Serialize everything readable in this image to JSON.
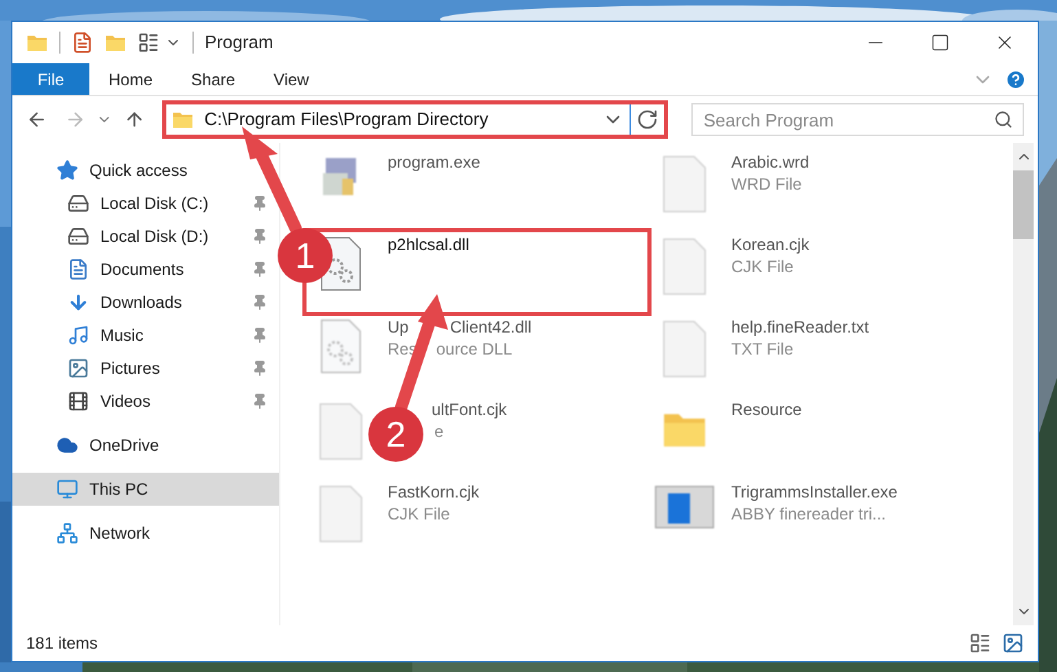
{
  "window": {
    "title": "Program"
  },
  "ribbon_tabs": [
    {
      "label": "File",
      "kind": "file"
    },
    {
      "label": "Home",
      "kind": "tab"
    },
    {
      "label": "Share",
      "kind": "tab"
    },
    {
      "label": "View",
      "kind": "tab"
    }
  ],
  "address": {
    "path": "C:\\Program Files\\Program Directory",
    "highlighted": true
  },
  "search": {
    "placeholder": "Search Program"
  },
  "sidebar": {
    "items": [
      {
        "label": "Quick access",
        "kind": "star",
        "selected": false,
        "children": [
          {
            "label": "Local Disk (C:)",
            "kind": "disk-c",
            "pinned": true,
            "selected": false
          },
          {
            "label": "Local Disk (D:)",
            "kind": "disk",
            "pinned": true,
            "selected": false
          },
          {
            "label": "Documents",
            "kind": "documents",
            "pinned": true,
            "selected": false
          },
          {
            "label": "Downloads",
            "kind": "downloads",
            "pinned": true,
            "selected": false
          },
          {
            "label": "Music",
            "kind": "music",
            "pinned": true,
            "selected": false
          },
          {
            "label": "Pictures",
            "kind": "pictures",
            "pinned": true,
            "selected": false
          },
          {
            "label": "Videos",
            "kind": "videos",
            "pinned": true,
            "selected": false
          }
        ]
      },
      {
        "label": "OneDrive",
        "kind": "cloud",
        "selected": false
      },
      {
        "label": "This PC",
        "kind": "pc",
        "selected": true
      },
      {
        "label": "Network",
        "kind": "network",
        "selected": false
      }
    ]
  },
  "files": [
    {
      "name": "program.exe",
      "kind": "exe",
      "highlighted": false
    },
    {
      "name": "Arabic.wrd",
      "type": "WRD File",
      "kind": "doc",
      "highlighted": false
    },
    {
      "name": "p2hlcsal.dll",
      "kind": "dll",
      "highlighted": true
    },
    {
      "name": "Korean.cjk",
      "type": "CJK File",
      "kind": "doc",
      "highlighted": false
    },
    {
      "name_lead": "Up",
      "name": "Client42.dll",
      "covered": true,
      "type_lead": "Res",
      "type": "ource DLL",
      "kind": "dll-blur",
      "highlighted": false
    },
    {
      "name": "help.fineReader.txt",
      "type": "TXT File",
      "kind": "doc",
      "highlighted": false
    },
    {
      "name": "ultFont.cjk",
      "covered": true,
      "type": "e",
      "kind": "doc",
      "highlighted": false
    },
    {
      "name": "Resource",
      "kind": "folder",
      "highlighted": false
    },
    {
      "name": "FastKorn.cjk",
      "type": "CJK File",
      "kind": "doc",
      "highlighted": false
    },
    {
      "name": "TrigrammsInstaller.exe",
      "type": "ABBY finereader tri...",
      "kind": "installer",
      "highlighted": false
    }
  ],
  "callouts": [
    {
      "label": "1"
    },
    {
      "label": "2"
    }
  ],
  "status_bar": {
    "count": "181 items"
  }
}
